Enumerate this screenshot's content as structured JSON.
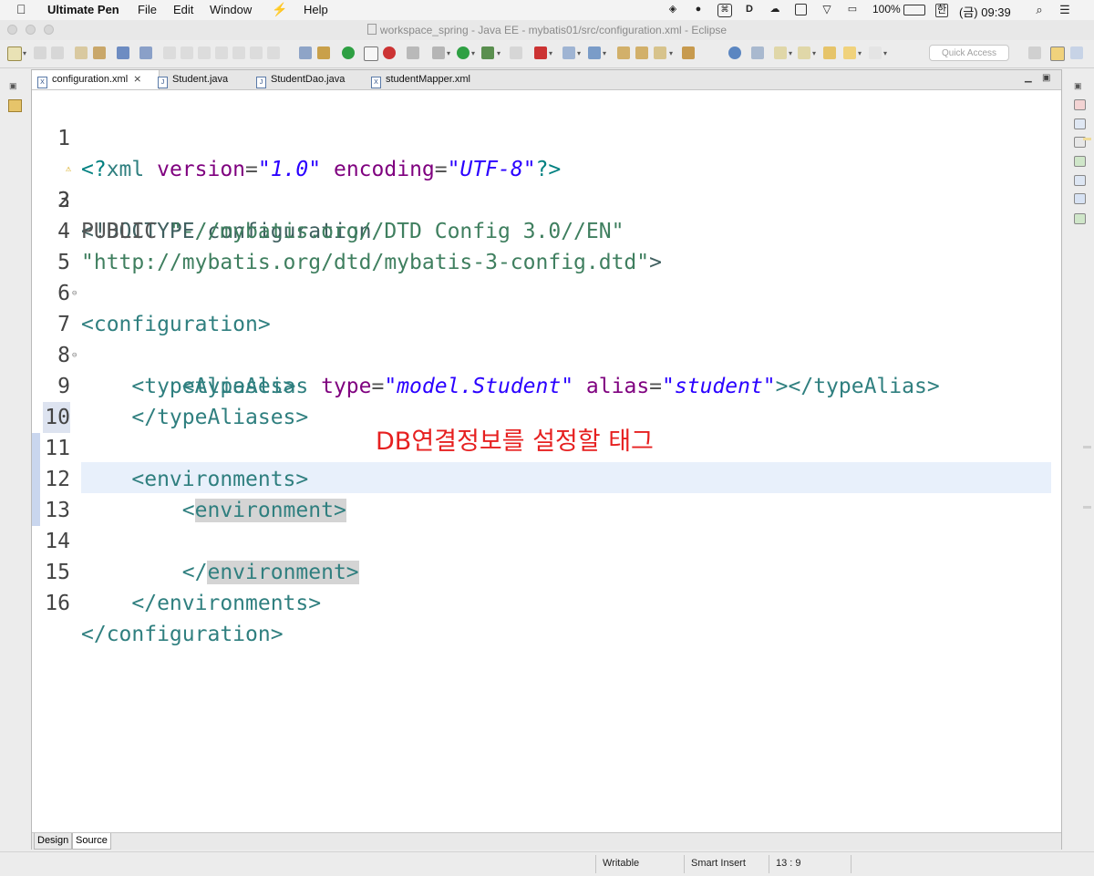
{
  "menubar": {
    "app_name": "Ultimate Pen",
    "items": [
      "File",
      "Edit",
      "Window",
      "Help"
    ],
    "battery": "100%",
    "input_lang": "한",
    "clock": "(금) 09:39"
  },
  "window": {
    "title": "workspace_spring - Java EE - mybatis01/src/configuration.xml - Eclipse"
  },
  "toolbar": {
    "quick_access_placeholder": "Quick Access"
  },
  "tabs": [
    {
      "label": "configuration.xml",
      "icon": "X",
      "active": true
    },
    {
      "label": "Student.java",
      "icon": "J",
      "active": false
    },
    {
      "label": "StudentDao.java",
      "icon": "J",
      "active": false
    },
    {
      "label": "studentMapper.xml",
      "icon": "X",
      "active": false
    }
  ],
  "code_lines": [
    {
      "num": "1",
      "text": "<?xml version=\"1.0\" encoding=\"UTF-8\"?>"
    },
    {
      "num": "2",
      "text": "<!DOCTYPE configuration"
    },
    {
      "num": "3",
      "text": "PUBLIC \"-//mybatis.org//DTD Config 3.0//EN\""
    },
    {
      "num": "4",
      "text": "\"http://mybatis.org/dtd/mybatis-3-config.dtd\">"
    },
    {
      "num": "5",
      "text": "<configuration>"
    },
    {
      "num": "6",
      "text": ""
    },
    {
      "num": "7",
      "text": "    <typeAliases>"
    },
    {
      "num": "8",
      "text": "        <typeAlias type=\"model.Student\" alias=\"student\"></typeAlias>"
    },
    {
      "num": "9",
      "text": "    </typeAliases>"
    },
    {
      "num": "10",
      "text": ""
    },
    {
      "num": "11",
      "text": "    <environments>"
    },
    {
      "num": "12",
      "text": "        <environment>"
    },
    {
      "num": "13",
      "text": ""
    },
    {
      "num": "14",
      "text": "        </environment>"
    },
    {
      "num": "15",
      "text": "    </environments>"
    },
    {
      "num": "16",
      "text": "</configuration>"
    }
  ],
  "annotation": "DB연결정보를 설정할 태그",
  "bottom_tabs": [
    "Design",
    "Source"
  ],
  "status": {
    "mode": "Writable",
    "insert": "Smart Insert",
    "position": "13 : 9"
  }
}
